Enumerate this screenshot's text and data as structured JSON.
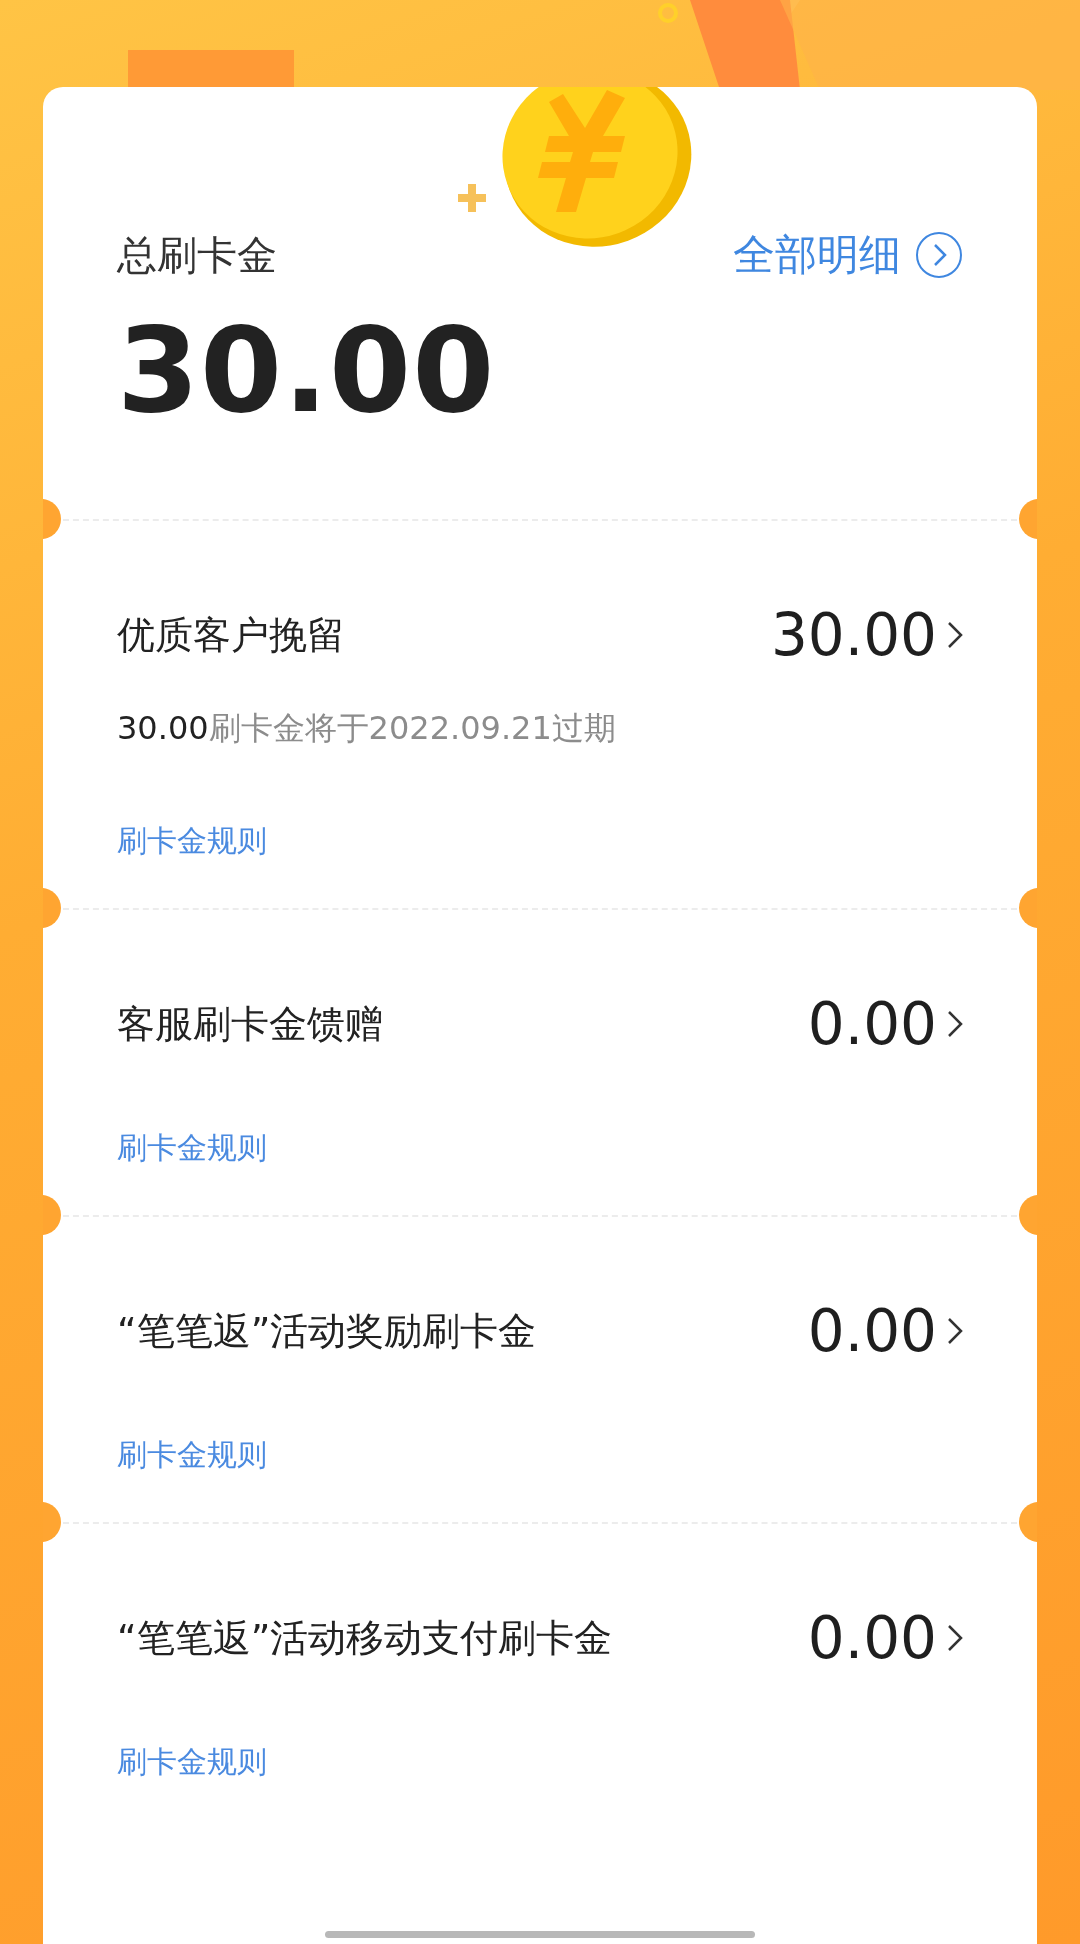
{
  "summary": {
    "label": "总刷卡金",
    "link": "全部明细",
    "amount": "30.00"
  },
  "sections": [
    {
      "title": "优质客户挽留",
      "amount": "30.00",
      "note_amount": "30.00",
      "note_text": "刷卡金将于2022.09.21过期",
      "rule": "刷卡金规则"
    },
    {
      "title": "客服刷卡金馈赠",
      "amount": "0.00",
      "rule": "刷卡金规则"
    },
    {
      "title": "“笔笔返”活动奖励刷卡金",
      "amount": "0.00",
      "rule": "刷卡金规则"
    },
    {
      "title": "“笔笔返”活动移动支付刷卡金",
      "amount": "0.00",
      "rule": "刷卡金规则"
    }
  ]
}
